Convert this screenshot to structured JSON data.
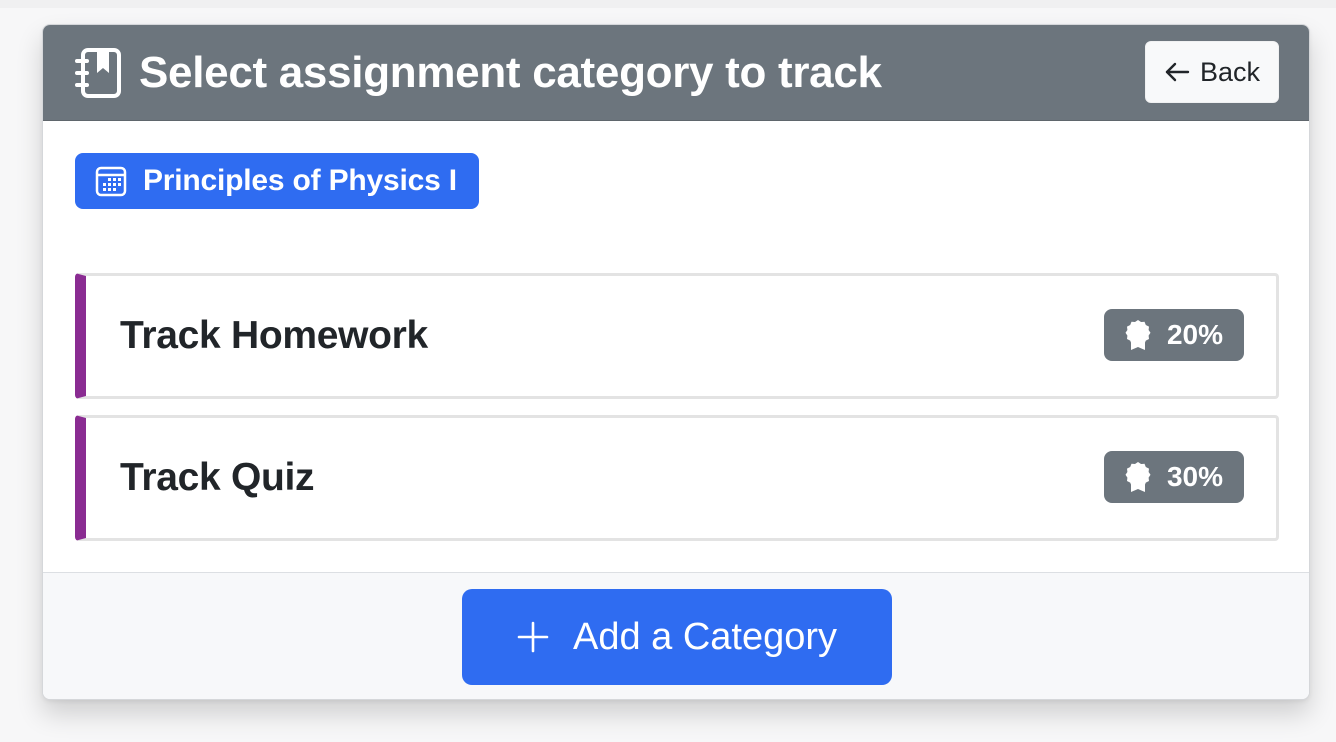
{
  "header": {
    "icon": "journal-bookmark-icon",
    "title": "Select assignment category to track",
    "back_label": "Back",
    "back_icon": "arrow-left-icon",
    "bg_color": "#6c757d"
  },
  "course": {
    "icon": "calendar-icon",
    "name": "Principles of Physics I",
    "color": "#2f6cf1"
  },
  "categories": [
    {
      "label": "Track Homework",
      "weight": "20%",
      "icon": "award-icon",
      "accent": "#8a2c92"
    },
    {
      "label": "Track Quiz",
      "weight": "30%",
      "icon": "award-icon",
      "accent": "#8a2c92"
    }
  ],
  "footer": {
    "add_label": "Add a Category",
    "add_icon": "plus-icon",
    "button_color": "#2f6cf1"
  }
}
